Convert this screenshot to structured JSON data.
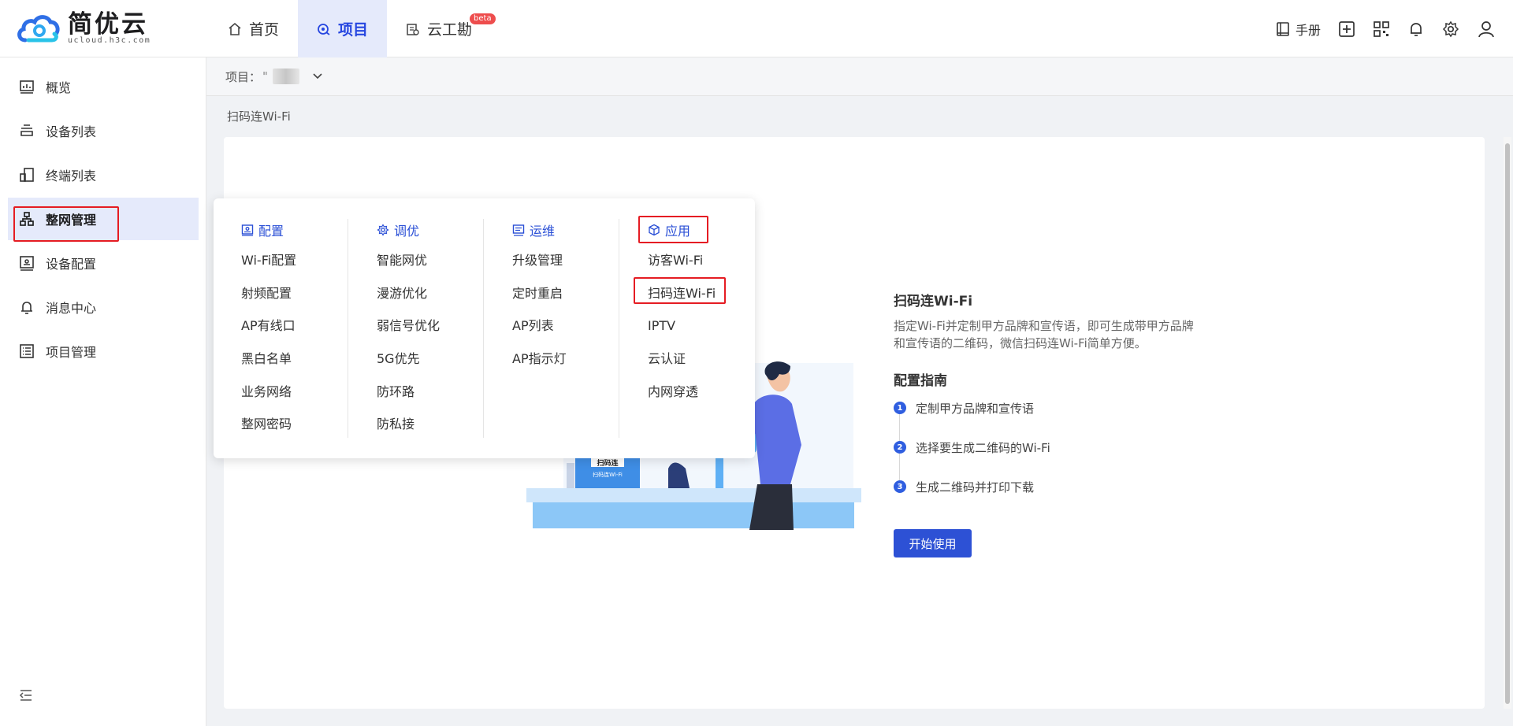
{
  "header": {
    "brand": "简优云",
    "domain": "ucloud.h3c.com",
    "nav": [
      {
        "label": "首页",
        "icon": "home-icon"
      },
      {
        "label": "项目",
        "icon": "project-icon"
      },
      {
        "label": "云工勘",
        "icon": "survey-icon",
        "badge": "beta"
      }
    ],
    "manual_label": "手册"
  },
  "sidebar": {
    "items": [
      {
        "label": "概览"
      },
      {
        "label": "设备列表"
      },
      {
        "label": "终端列表"
      },
      {
        "label": "整网管理"
      },
      {
        "label": "设备配置"
      },
      {
        "label": "消息中心"
      },
      {
        "label": "项目管理"
      }
    ]
  },
  "filter": {
    "project_label": "项目：",
    "project_value": "\""
  },
  "breadcrumb": "扫码连Wi-Fi",
  "menu": {
    "columns": [
      {
        "title": "配置",
        "items": [
          "Wi-Fi配置",
          "射频配置",
          "AP有线口",
          "黑白名单",
          "业务网络",
          "整网密码"
        ]
      },
      {
        "title": "调优",
        "items": [
          "智能网优",
          "漫游优化",
          "弱信号优化",
          "5G优先",
          "防环路",
          "防私接"
        ]
      },
      {
        "title": "运维",
        "items": [
          "升级管理",
          "定时重启",
          "AP列表",
          "AP指示灯"
        ]
      },
      {
        "title": "应用",
        "items": [
          "访客Wi-Fi",
          "扫码连Wi-Fi",
          "IPTV",
          "云认证",
          "内网穿透"
        ]
      }
    ]
  },
  "intro": {
    "title": "扫码连Wi-Fi",
    "description": "指定Wi-Fi并定制甲方品牌和宣传语，即可生成带甲方品牌和宣传语的二维码，微信扫码连Wi-Fi简单方便。",
    "guide_title": "配置指南",
    "steps": [
      {
        "num": "1",
        "text": "定制甲方品牌和宣传语"
      },
      {
        "num": "2",
        "text": "选择要生成二维码的Wi-Fi"
      },
      {
        "num": "3",
        "text": "生成二维码并打印下载"
      }
    ],
    "start_button": "开始使用",
    "illustration": {
      "sign_text": "扫码连Wi-Fi",
      "sign_top_text": "扫码连"
    }
  },
  "colors": {
    "accent": "#2a4fd6",
    "highlight": "#e51c23",
    "active_bg": "#e5eafb"
  }
}
